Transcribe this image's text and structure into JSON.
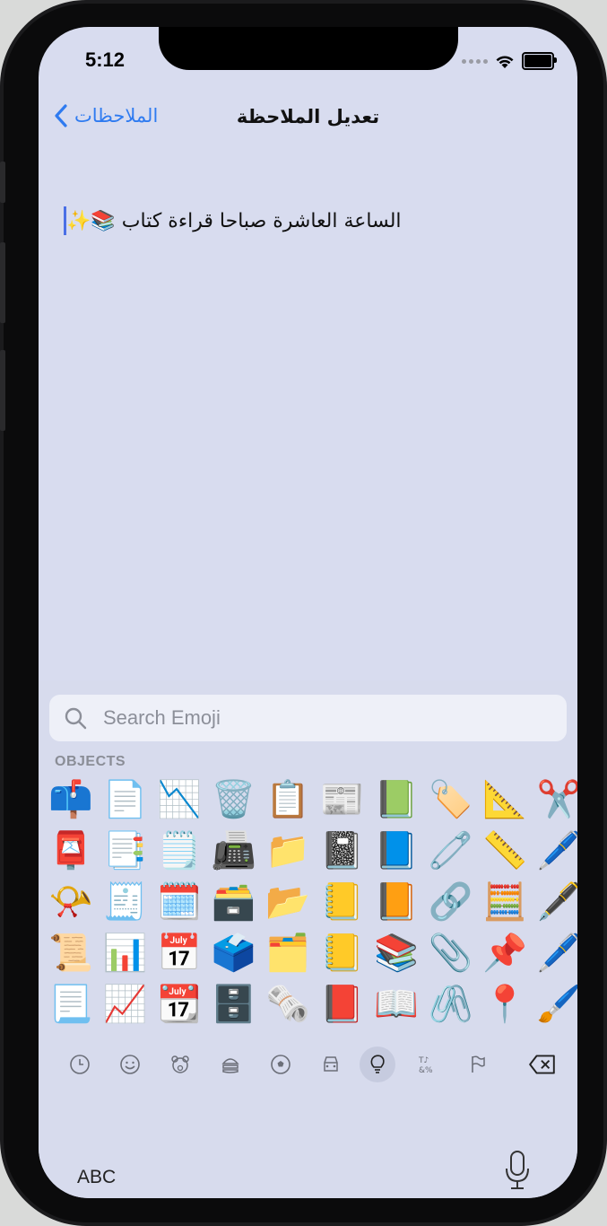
{
  "status_bar": {
    "time": "5:12"
  },
  "nav": {
    "back_label": "الملاحظات",
    "title": "تعديل الملاحظة"
  },
  "note": {
    "text": "الساعة العاشرة صباحا قراءة كتاب 📚✨"
  },
  "emoji_keyboard": {
    "search_placeholder": "Search Emoji",
    "category_label": "OBJECTS",
    "emojis": [
      "📫",
      "📄",
      "📉",
      "🗑️",
      "📋",
      "📰",
      "📗",
      "🏷️",
      "📐",
      "✂️",
      "📮",
      "📑",
      "🗒️",
      "📠",
      "📁",
      "📓",
      "📘",
      "🧷",
      "📏",
      "🖊️",
      "📯",
      "🧾",
      "🗓️",
      "🗃️",
      "📂",
      "📒",
      "📙",
      "🔗",
      "🧮",
      "🖋️",
      "📜",
      "📊",
      "📅",
      "🗳️",
      "🗂️",
      "📒",
      "📚",
      "📎",
      "📌",
      "🖊️",
      "📃",
      "📈",
      "📆",
      "🗄️",
      "🗞️",
      "📕",
      "📖",
      "🖇️",
      "📍",
      "🖌️"
    ],
    "categories": [
      {
        "name": "recent",
        "icon": "clock-icon"
      },
      {
        "name": "smileys",
        "icon": "smiley-icon"
      },
      {
        "name": "animals",
        "icon": "bear-icon"
      },
      {
        "name": "food",
        "icon": "burger-icon"
      },
      {
        "name": "activity",
        "icon": "ball-icon"
      },
      {
        "name": "travel",
        "icon": "car-icon"
      },
      {
        "name": "objects",
        "icon": "lightbulb-icon",
        "active": true
      },
      {
        "name": "symbols",
        "icon": "symbols-icon"
      },
      {
        "name": "flags",
        "icon": "flag-icon"
      }
    ],
    "abc_label": "ABC"
  },
  "colors": {
    "accent": "#2f7bf0",
    "screen_bg": "#d8dcef",
    "keyboard_bg": "#d7dbed",
    "active_category_bg": "#c6cbdf"
  }
}
